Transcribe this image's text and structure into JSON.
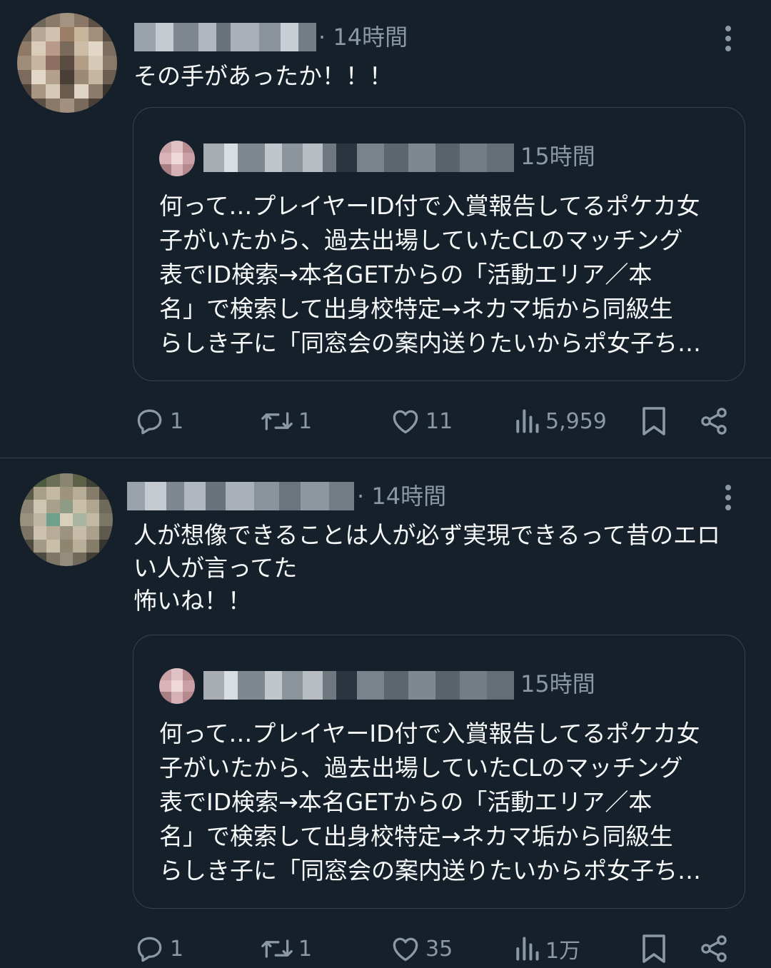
{
  "tweets": [
    {
      "time": "· 14時間",
      "text": "その手があったか！！！",
      "quote": {
        "time": "15時間",
        "text": "何って…プレイヤーID付で入賞報告してるポケカ女\n子がいたから、過去出場していたCLのマッチング\n表でID検索→本名GETからの「活動エリア／本\n名」で検索して出身校特定→ネカマ垢から同級生\nらしき子に「同窓会の案内送りたいからポ女子ち…"
      },
      "actions": {
        "replies": "1",
        "reposts": "1",
        "likes": "11",
        "views": "5,959"
      }
    },
    {
      "time": "· 14時間",
      "text": "人が想像できることは人が必ず実現できるって昔のエロ\nい人が言ってた\n怖いね！！",
      "quote": {
        "time": "15時間",
        "text": "何って…プレイヤーID付で入賞報告してるポケカ女\n子がいたから、過去出場していたCLのマッチング\n表でID検索→本名GETからの「活動エリア／本\n名」で検索して出身校特定→ネカマ垢から同級生\nらしき子に「同窓会の案内送りたいからポ女子ち…"
      },
      "actions": {
        "replies": "1",
        "reposts": "1",
        "likes": "35",
        "views": "1万"
      }
    }
  ],
  "colors": {
    "background": "#15202b",
    "text": "#f7f9f9",
    "secondary": "#8b98a5",
    "border": "#38444d"
  },
  "icons": [
    "reply-icon",
    "repost-icon",
    "like-icon",
    "views-icon",
    "bookmark-icon",
    "share-icon",
    "more-icon"
  ]
}
